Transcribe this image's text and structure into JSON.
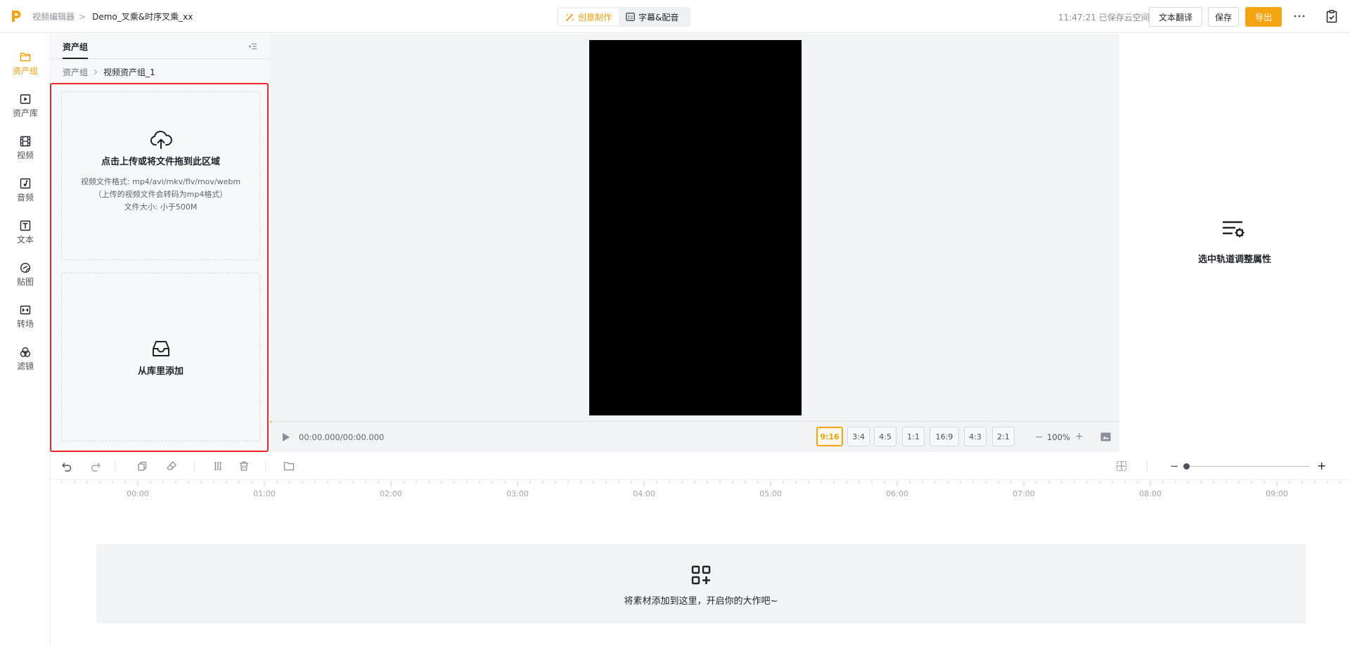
{
  "header": {
    "breadcrumb_root": "视频编辑器",
    "breadcrumb_sep": ">",
    "project_name": "Demo_叉乘&时序叉乘_xx",
    "mode_tabs": [
      {
        "label": "创意制作",
        "active": true
      },
      {
        "label": "字幕&配音",
        "active": false
      }
    ],
    "save_status": "11:47:21 已保存云空间",
    "translate_label": "文本翻译",
    "save_label": "保存",
    "export_label": "导出",
    "more_icon": "more-horizontal-icon",
    "clipboard_icon": "clipboard-check-icon"
  },
  "sidebar": {
    "items": [
      {
        "label": "资产组",
        "icon": "folder-icon",
        "active": true
      },
      {
        "label": "资产库",
        "icon": "video-library-icon",
        "active": false
      },
      {
        "label": "视频",
        "icon": "film-icon",
        "active": false
      },
      {
        "label": "音频",
        "icon": "music-icon",
        "active": false
      },
      {
        "label": "文本",
        "icon": "text-icon",
        "active": false
      },
      {
        "label": "贴图",
        "icon": "sticker-icon",
        "active": false
      },
      {
        "label": "转场",
        "icon": "transition-icon",
        "active": false
      },
      {
        "label": "滤镜",
        "icon": "filter-icon",
        "active": false
      }
    ]
  },
  "asset_panel": {
    "tab_label": "资产组",
    "breadcrumb_root": "资产组",
    "breadcrumb_current": "视频资产组_1",
    "upload": {
      "title": "点击上传或将文件拖到此区域",
      "formats": "视频文件格式: mp4/avi/mkv/flv/mov/webm",
      "note": "（上传的视频文件会转码为mp4格式）",
      "size_limit": "文件大小: 小于500M"
    },
    "library_title": "从库里添加"
  },
  "preview": {
    "timecode": "00:00.000/00:00.000",
    "ratios": [
      {
        "label": "9:16",
        "active": true
      },
      {
        "label": "3:4",
        "active": false
      },
      {
        "label": "4:5",
        "active": false
      },
      {
        "label": "1:1",
        "active": false
      },
      {
        "label": "16:9",
        "active": false
      },
      {
        "label": "4:3",
        "active": false
      },
      {
        "label": "2:1",
        "active": false
      }
    ],
    "zoom_minus": "−",
    "zoom_value": "100%",
    "zoom_plus": "+"
  },
  "properties": {
    "hint": "选中轨道调整属性"
  },
  "timeline": {
    "ruler_labels": [
      "00:00",
      "01:00",
      "02:00",
      "03:00",
      "04:00",
      "05:00",
      "06:00",
      "07:00",
      "08:00",
      "09:00"
    ],
    "zoom_minus": "−",
    "zoom_plus": "+",
    "empty_hint": "将素材添加到这里，开启你的大作吧~"
  },
  "colors": {
    "accent": "#f5a511",
    "highlight_frame": "#ea2626",
    "canvas": "#000000"
  }
}
